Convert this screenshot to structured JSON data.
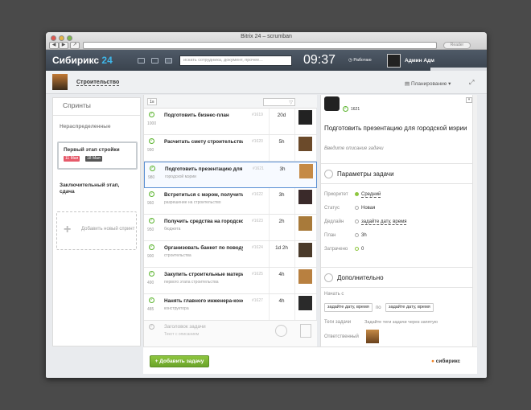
{
  "window": {
    "title": "Bitrix 24 – scrumban",
    "reader": "Reader"
  },
  "header": {
    "logo_text": "Сибирикс",
    "logo_num": "24",
    "search_placeholder": "искать сотрудника, документ, прочее...",
    "clock": "09:37",
    "workday": "Работаю",
    "user_name": "Админ Адм",
    "counters": [
      "0",
      "0"
    ]
  },
  "project": {
    "name": "Строительство",
    "planning": "Планирование"
  },
  "sprints": {
    "title": "Спринты",
    "unassigned": "Нераспределенные",
    "items": [
      {
        "name": "Первый этап стройки",
        "date_start": "11 Мая",
        "date_end": "18 Мая"
      },
      {
        "name": "Заключительный этап, сдача"
      }
    ],
    "add_label": "Добавить новый спринт"
  },
  "tasks": {
    "sort_label": "1≡",
    "rows": [
      {
        "num": "1000",
        "name": "Подготовить бизнес-план",
        "sub": "",
        "id": "#1619",
        "duration": "20d"
      },
      {
        "num": "990",
        "name": "Расчитать смету строительства",
        "sub": "",
        "id": "#1620",
        "duration": "5h"
      },
      {
        "num": "980",
        "name": "Подготовить презентацию для городской мэрии",
        "sub": "городской мэрии",
        "id": "#1621",
        "duration": "3h"
      },
      {
        "num": "960",
        "name": "Встретиться с мэром, получить разрешение",
        "sub": "разрешение на строительство",
        "id": "#1622",
        "duration": "3h"
      },
      {
        "num": "950",
        "name": "Получить средства на городское строительство",
        "sub": "бюджета",
        "id": "#1623",
        "duration": "2h"
      },
      {
        "num": "900",
        "name": "Организовать банкет по поводу начала",
        "sub": "строительства",
        "id": "#1624",
        "duration": "1d 2h"
      },
      {
        "num": "490",
        "name": "Закупить строительные материалы",
        "sub": "первого этапа строительства",
        "id": "#1625",
        "duration": "4h"
      },
      {
        "num": "485",
        "name": "Нанять главного инженера-конструктора",
        "sub": "конструктора",
        "id": "#1627",
        "duration": "4h"
      }
    ],
    "quick_add_name": "Заголовок задачи",
    "quick_add_desc": "Текст с описанием"
  },
  "detail": {
    "id": "1621",
    "title": "Подготовить презентацию для городской мэрии",
    "description_placeholder": "Введите описание задачи",
    "params_title": "Параметры задачи",
    "priority_label": "Приоритет",
    "priority_value": "Средний",
    "status_label": "Статус",
    "status_value": "Новая",
    "deadline_label": "Дедлайн",
    "deadline_value": "задайте дату, время",
    "plan_label": "План",
    "plan_value": "3h",
    "spent_label": "Затрачено",
    "spent_value": "0",
    "extra_title": "Дополнительно",
    "start_label": "Начать с",
    "start_value": "задайте дату, время",
    "to_label": "по",
    "end_value": "задайте дату, время",
    "tags_label": "Теги задачи",
    "tags_value": "Задайте теги задачи через запятую",
    "responsible_label": "Ответственный"
  },
  "footer": {
    "add_task": "Добавить задачу",
    "brand": "сибирикс"
  },
  "colors": {
    "accent": "#3fb6e8",
    "green": "#6aa329",
    "header": "#3f4853"
  }
}
